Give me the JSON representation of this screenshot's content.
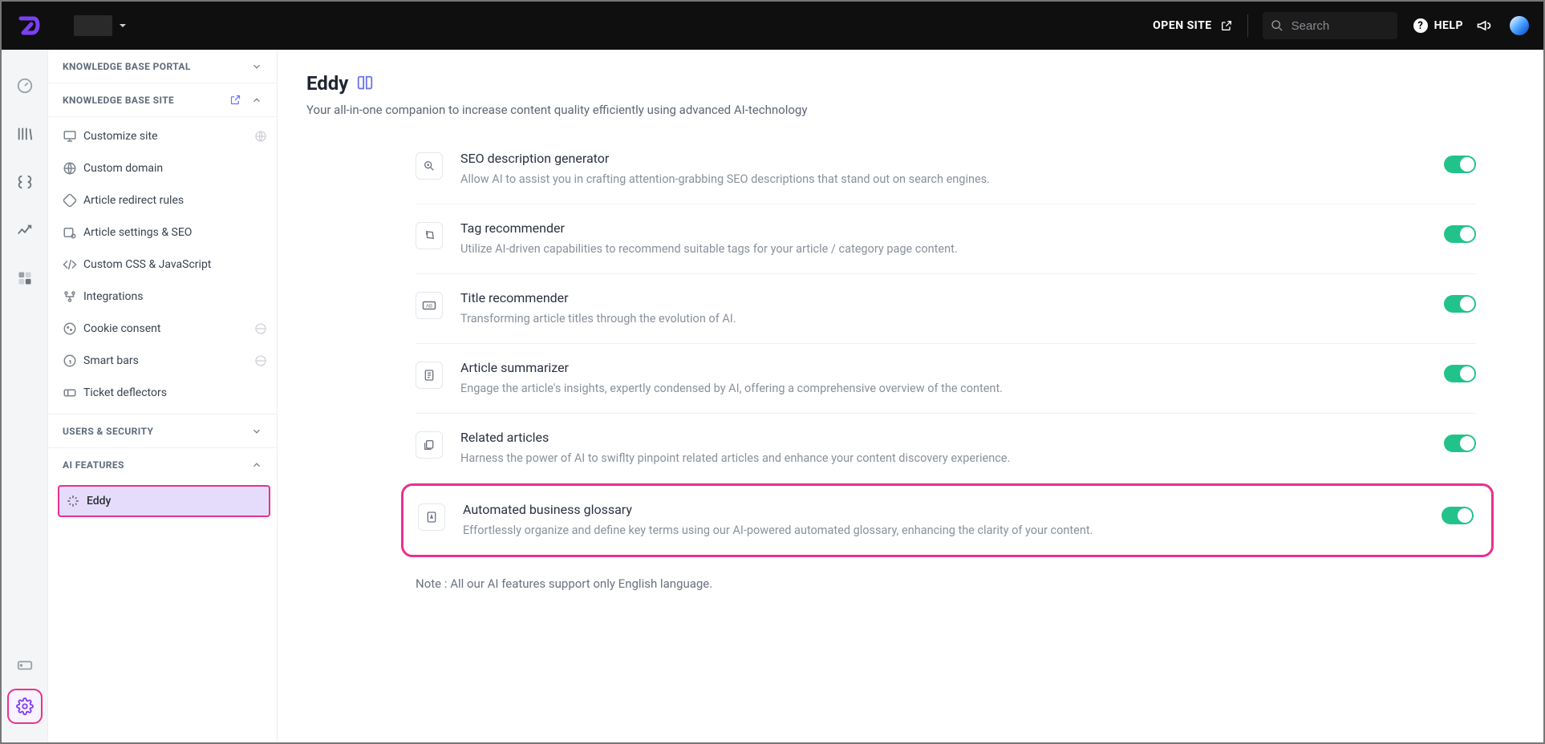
{
  "topbar": {
    "open_site": "OPEN SITE",
    "search_placeholder": "Search",
    "help_label": "HELP"
  },
  "sidebar": {
    "sections": {
      "kb_portal": "KNOWLEDGE BASE PORTAL",
      "kb_site": "KNOWLEDGE BASE SITE",
      "users_security": "USERS & SECURITY",
      "ai_features": "AI FEATURES"
    },
    "kb_site_items": [
      "Customize site",
      "Custom domain",
      "Article redirect rules",
      "Article settings & SEO",
      "Custom CSS & JavaScript",
      "Integrations",
      "Cookie consent",
      "Smart bars",
      "Ticket deflectors"
    ],
    "ai_items": [
      "Eddy"
    ]
  },
  "page": {
    "title": "Eddy",
    "subtitle": "Your all-in-one companion to increase content quality efficiently using advanced AI-technology"
  },
  "settings": [
    {
      "title": "SEO description generator",
      "desc": "Allow AI to assist you in crafting attention-grabbing SEO descriptions that stand out on search engines."
    },
    {
      "title": "Tag recommender",
      "desc": "Utilize AI-driven capabilities to recommend suitable tags for your article / category page content."
    },
    {
      "title": "Title recommender",
      "desc": "Transforming article titles through the evolution of AI."
    },
    {
      "title": "Article summarizer",
      "desc": "Engage the article's insights, expertly condensed by AI, offering a comprehensive overview of the content."
    },
    {
      "title": "Related articles",
      "desc": "Harness the power of AI to swiflty pinpoint related articles and enhance your content discovery experience."
    },
    {
      "title": "Automated business glossary",
      "desc": "Effortlessly organize and define key terms using our AI-powered automated glossary, enhancing the clarity of your content."
    }
  ],
  "footnote": "Note : All our AI features support only English language."
}
